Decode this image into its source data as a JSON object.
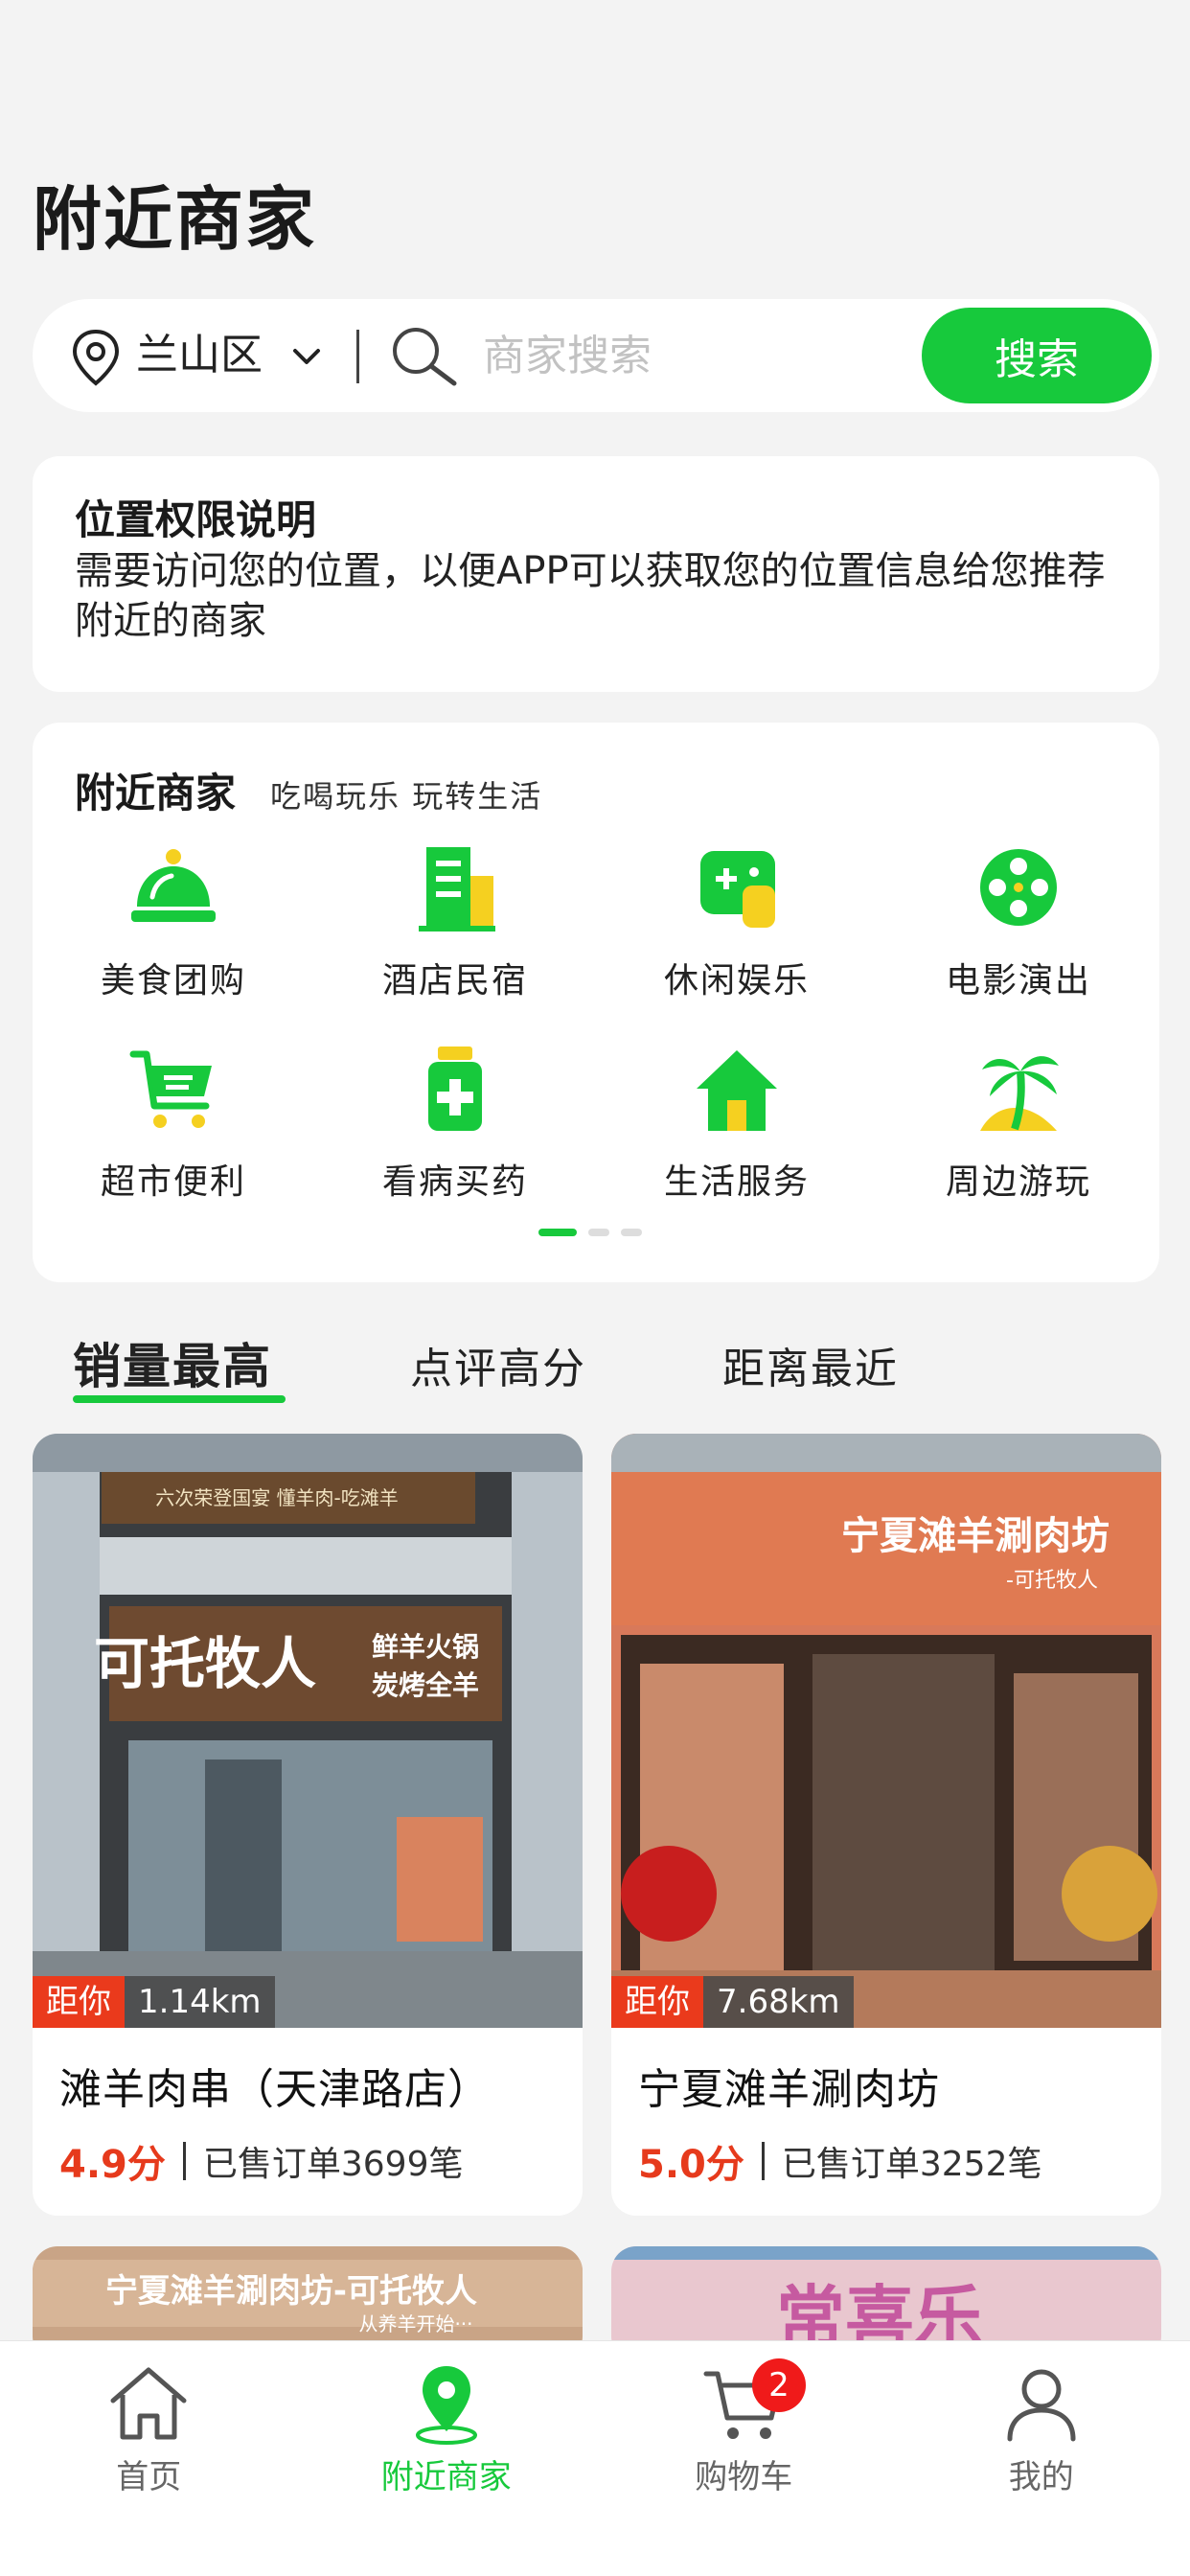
{
  "header": {
    "title": "附近商家"
  },
  "search": {
    "district": "兰山区",
    "placeholder": "商家搜索",
    "button_label": "搜索"
  },
  "permission": {
    "title": "位置权限说明",
    "text": "需要访问您的位置，以便APP可以获取您的位置信息给您推荐附近的商家"
  },
  "categories": {
    "title": "附近商家",
    "subtitle": "吃喝玩乐 玩转生活",
    "items": [
      {
        "label": "美食团购",
        "icon": "food-cloche-icon"
      },
      {
        "label": "酒店民宿",
        "icon": "hotel-building-icon"
      },
      {
        "label": "休闲娱乐",
        "icon": "gamepad-icon"
      },
      {
        "label": "电影演出",
        "icon": "film-reel-icon"
      },
      {
        "label": "超市便利",
        "icon": "shopping-cart-icon"
      },
      {
        "label": "看病买药",
        "icon": "medicine-icon"
      },
      {
        "label": "生活服务",
        "icon": "house-icon"
      },
      {
        "label": "周边游玩",
        "icon": "palm-tree-icon"
      }
    ],
    "page_count": 3,
    "current_page": 1
  },
  "sort_tabs": [
    {
      "label": "销量最高",
      "active": true
    },
    {
      "label": "点评高分",
      "active": false
    },
    {
      "label": "距离最近",
      "active": false
    }
  ],
  "shops": [
    {
      "name": "滩羊肉串（天津路店）",
      "distance_label": "距你",
      "distance": "1.14km",
      "rating": "4.9分",
      "sales": "已售订单3699笔",
      "sign_main": "可托牧人",
      "sign_sub1": "鲜羊火锅",
      "sign_sub2": "炭烤全羊",
      "sign_top": "六次荣登国宴 懂羊肉-吃滩羊"
    },
    {
      "name": "宁夏滩羊涮肉坊",
      "distance_label": "距你",
      "distance": "7.68km",
      "rating": "5.0分",
      "sales": "已售订单3252笔",
      "sign_main": "宁夏滩羊涮肉坊",
      "sign_sub1": "-可托牧人"
    },
    {
      "sign_main": "宁夏滩羊涮肉坊-可托牧人",
      "sign_sub1": "从养羊开始···"
    },
    {
      "sign_main": "常喜乐"
    }
  ],
  "bottom_nav": [
    {
      "label": "首页",
      "icon": "home-icon",
      "active": false
    },
    {
      "label": "附近商家",
      "icon": "location-pin-icon",
      "active": true
    },
    {
      "label": "购物车",
      "icon": "cart-icon",
      "active": false,
      "badge": "2"
    },
    {
      "label": "我的",
      "icon": "user-icon",
      "active": false
    }
  ],
  "colors": {
    "accent": "#17c93c",
    "rating": "#e63a1c",
    "distance_tag": "#ea3a1c",
    "badge": "#f01a1a"
  }
}
